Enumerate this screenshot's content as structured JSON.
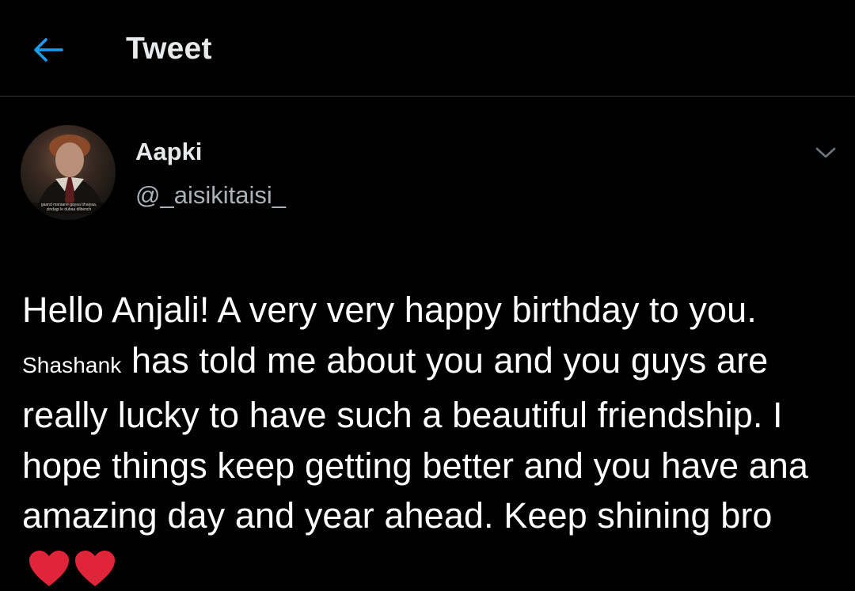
{
  "header": {
    "back_icon": "arrow-left-icon",
    "title": "Tweet"
  },
  "tweet": {
    "author": {
      "name": "Aapki",
      "handle": "@_aisikitaisi_",
      "avatar_caption": "gaand maraane gayaa bhaiyaa, zindagi le dubaa dilbench"
    },
    "more_icon": "chevron-down-icon",
    "text": {
      "part1": "Hello Anjali! A very very happy birthday to you. ",
      "name_mention": "Shashank",
      "part2": " has told me about you and you guys are really lucky to have such a beautiful friendship. I hope things keep getting better and you have ana amazing day and year ahead. Keep shining bro",
      "emoji": [
        "red-heart-icon",
        "red-heart-icon"
      ]
    }
  },
  "colors": {
    "background": "#000000",
    "accent_blue": "#1d9bf0",
    "text_primary": "#e7e9ea",
    "text_secondary": "#aab2b8",
    "divider": "#2f3336",
    "heart_red": "#e0243a"
  }
}
